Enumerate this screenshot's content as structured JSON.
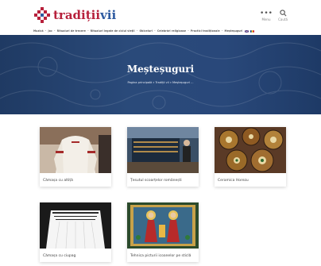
{
  "header": {
    "logo_text_a": "tradiții",
    "logo_text_b": "vii",
    "menu_label": "Menu",
    "search_label": "Caută"
  },
  "nav": {
    "items": [
      "Muzică",
      "Joc",
      "Ritualuri de trecere",
      "Ritualuri legate de ciclul vieții",
      "Obiceiuri",
      "Celebrări religioase",
      "Practici tradiționale",
      "Meșteșuguri"
    ]
  },
  "hero": {
    "title": "Meșteșuguri",
    "breadcrumb_home": "Pagina principală",
    "breadcrumb_parent": "Tradiții vii",
    "breadcrumb_current": "Meșteșuguri ..."
  },
  "cards": [
    {
      "title": "Cămașa cu altiță"
    },
    {
      "title": "Țesutul scoarțelor românești"
    },
    {
      "title": "Ceramica Horezu"
    },
    {
      "title": "Cămașa cu ciupag"
    },
    {
      "title": "Tehnica picturii icoanelor pe sticlă"
    }
  ],
  "colors": {
    "brand_red": "#b7213c",
    "brand_blue": "#2d5aa0",
    "hero_blue": "#2a4a7a"
  }
}
